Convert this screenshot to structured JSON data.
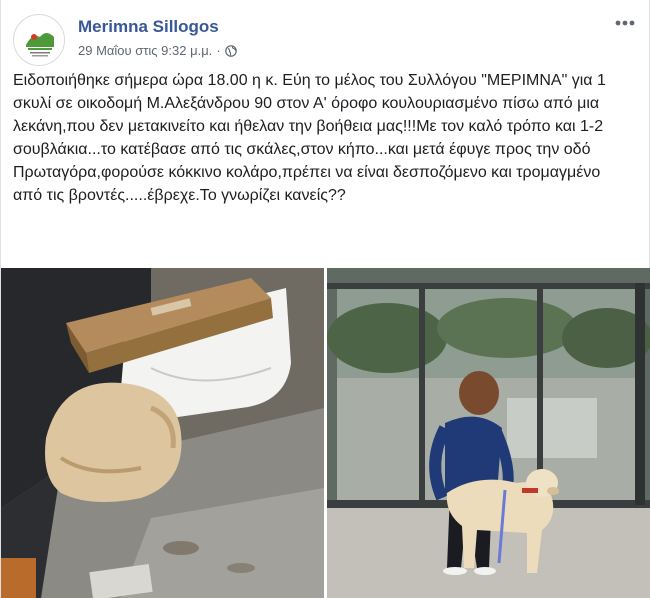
{
  "post": {
    "page_name": "Merimna Sillogos",
    "timestamp": "29 Μαΐου στις 9:32 μ.μ.",
    "separator": "·",
    "privacy_icon": "globe-icon",
    "more_icon": "more-horizontal-icon",
    "text": "Ειδοποιήθηκε σήμερα ώρα 18.00 η κ. Εύη το μέλος του Συλλόγου \"ΜΕΡΙΜΝΑ\" για 1 σκυλί σε οικοδομή Μ.Αλεξάνδρου 90 στον Α' όροφο κουλουριασμένο πίσω από μια λεκάνη,που δεν μετακινείτο και ήθελαν την βοήθεια μας!!!Με τον καλό τρόπο και 1-2 σουβλάκια...το κατέβασε από τις σκάλες,στον κήπο...και μετά έφυγε προς την οδό Πρωταγόρα,φορούσε κόκκινο κολάρο,πρέπει να είναι δεσποζόμενο και τρομαγμένο από τις βροντές.....έβρεχε.Το γνωρίζει κανείς??"
  },
  "colors": {
    "link": "#385898",
    "meta": "#616770",
    "text": "#1c1e21"
  }
}
